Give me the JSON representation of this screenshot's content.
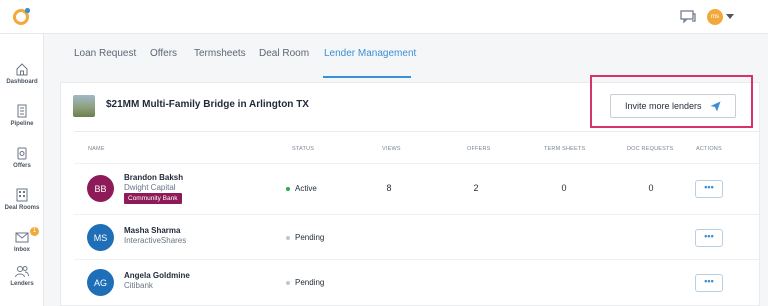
{
  "topbar": {
    "avatar_initials": "ms"
  },
  "sidebar": {
    "items": [
      {
        "label": "Dashboard",
        "icon": "home-icon"
      },
      {
        "label": "Pipeline",
        "icon": "pipeline-icon"
      },
      {
        "label": "Offers",
        "icon": "offers-icon"
      },
      {
        "label": "Deal Rooms",
        "icon": "deal-rooms-icon"
      },
      {
        "label": "Inbox",
        "icon": "inbox-icon",
        "badge": "1"
      },
      {
        "label": "Lenders",
        "icon": "lenders-icon"
      }
    ]
  },
  "tabs": [
    "Loan Request",
    "Offers",
    "Termsheets",
    "Deal Room",
    "Lender Management"
  ],
  "active_tab": "Lender Management",
  "deal": {
    "title": "$21MM Multi-Family Bridge in Arlington TX"
  },
  "invite_button": {
    "label": "Invite more lenders"
  },
  "table": {
    "headers": {
      "name": "NAME",
      "status": "STATUS",
      "views": "VIEWS",
      "offers": "OFFERS",
      "term_sheets": "TERM SHEETS",
      "doc_requests": "DOC REQUESTS",
      "actions": "ACTIONS"
    },
    "rows": [
      {
        "initials": "BB",
        "name": "Brandon Baksh",
        "org": "Dwight Capital",
        "tag": "Community Bank",
        "status": "Active",
        "views": "8",
        "offers": "2",
        "term_sheets": "0",
        "doc_requests": "0",
        "actions": "•••",
        "avatar_color": "#8e1b59",
        "status_color": "#2fa84f"
      },
      {
        "initials": "MS",
        "name": "Masha Sharma",
        "org": "InteractiveShares",
        "status": "Pending",
        "views": "",
        "offers": "",
        "term_sheets": "",
        "doc_requests": "",
        "actions": "•••",
        "avatar_color": "#1e6fb8",
        "status_color": "#c2c7cf"
      },
      {
        "initials": "AG",
        "name": "Angela Goldmine",
        "org": "Citibank",
        "status": "Pending",
        "views": "",
        "offers": "",
        "term_sheets": "",
        "doc_requests": "",
        "actions": "•••",
        "avatar_color": "#1e6fb8",
        "status_color": "#c2c7cf"
      }
    ]
  },
  "colors": {
    "accent": "#3b8fd6",
    "highlight": "#d6336c",
    "badge": "#f2a93b"
  }
}
